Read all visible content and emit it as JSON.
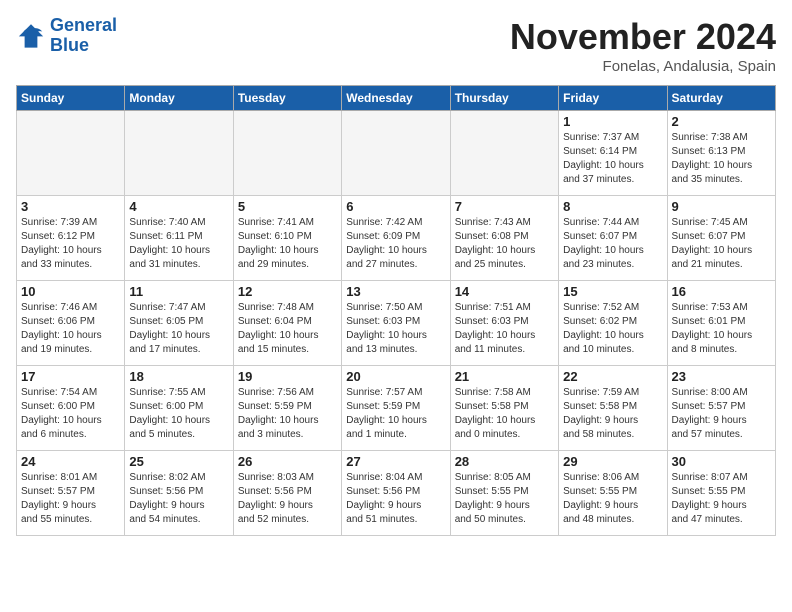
{
  "logo": {
    "line1": "General",
    "line2": "Blue"
  },
  "title": "November 2024",
  "location": "Fonelas, Andalusia, Spain",
  "weekdays": [
    "Sunday",
    "Monday",
    "Tuesday",
    "Wednesday",
    "Thursday",
    "Friday",
    "Saturday"
  ],
  "weeks": [
    [
      {
        "day": "",
        "info": ""
      },
      {
        "day": "",
        "info": ""
      },
      {
        "day": "",
        "info": ""
      },
      {
        "day": "",
        "info": ""
      },
      {
        "day": "",
        "info": ""
      },
      {
        "day": "1",
        "info": "Sunrise: 7:37 AM\nSunset: 6:14 PM\nDaylight: 10 hours\nand 37 minutes."
      },
      {
        "day": "2",
        "info": "Sunrise: 7:38 AM\nSunset: 6:13 PM\nDaylight: 10 hours\nand 35 minutes."
      }
    ],
    [
      {
        "day": "3",
        "info": "Sunrise: 7:39 AM\nSunset: 6:12 PM\nDaylight: 10 hours\nand 33 minutes."
      },
      {
        "day": "4",
        "info": "Sunrise: 7:40 AM\nSunset: 6:11 PM\nDaylight: 10 hours\nand 31 minutes."
      },
      {
        "day": "5",
        "info": "Sunrise: 7:41 AM\nSunset: 6:10 PM\nDaylight: 10 hours\nand 29 minutes."
      },
      {
        "day": "6",
        "info": "Sunrise: 7:42 AM\nSunset: 6:09 PM\nDaylight: 10 hours\nand 27 minutes."
      },
      {
        "day": "7",
        "info": "Sunrise: 7:43 AM\nSunset: 6:08 PM\nDaylight: 10 hours\nand 25 minutes."
      },
      {
        "day": "8",
        "info": "Sunrise: 7:44 AM\nSunset: 6:07 PM\nDaylight: 10 hours\nand 23 minutes."
      },
      {
        "day": "9",
        "info": "Sunrise: 7:45 AM\nSunset: 6:07 PM\nDaylight: 10 hours\nand 21 minutes."
      }
    ],
    [
      {
        "day": "10",
        "info": "Sunrise: 7:46 AM\nSunset: 6:06 PM\nDaylight: 10 hours\nand 19 minutes."
      },
      {
        "day": "11",
        "info": "Sunrise: 7:47 AM\nSunset: 6:05 PM\nDaylight: 10 hours\nand 17 minutes."
      },
      {
        "day": "12",
        "info": "Sunrise: 7:48 AM\nSunset: 6:04 PM\nDaylight: 10 hours\nand 15 minutes."
      },
      {
        "day": "13",
        "info": "Sunrise: 7:50 AM\nSunset: 6:03 PM\nDaylight: 10 hours\nand 13 minutes."
      },
      {
        "day": "14",
        "info": "Sunrise: 7:51 AM\nSunset: 6:03 PM\nDaylight: 10 hours\nand 11 minutes."
      },
      {
        "day": "15",
        "info": "Sunrise: 7:52 AM\nSunset: 6:02 PM\nDaylight: 10 hours\nand 10 minutes."
      },
      {
        "day": "16",
        "info": "Sunrise: 7:53 AM\nSunset: 6:01 PM\nDaylight: 10 hours\nand 8 minutes."
      }
    ],
    [
      {
        "day": "17",
        "info": "Sunrise: 7:54 AM\nSunset: 6:00 PM\nDaylight: 10 hours\nand 6 minutes."
      },
      {
        "day": "18",
        "info": "Sunrise: 7:55 AM\nSunset: 6:00 PM\nDaylight: 10 hours\nand 5 minutes."
      },
      {
        "day": "19",
        "info": "Sunrise: 7:56 AM\nSunset: 5:59 PM\nDaylight: 10 hours\nand 3 minutes."
      },
      {
        "day": "20",
        "info": "Sunrise: 7:57 AM\nSunset: 5:59 PM\nDaylight: 10 hours\nand 1 minute."
      },
      {
        "day": "21",
        "info": "Sunrise: 7:58 AM\nSunset: 5:58 PM\nDaylight: 10 hours\nand 0 minutes."
      },
      {
        "day": "22",
        "info": "Sunrise: 7:59 AM\nSunset: 5:58 PM\nDaylight: 9 hours\nand 58 minutes."
      },
      {
        "day": "23",
        "info": "Sunrise: 8:00 AM\nSunset: 5:57 PM\nDaylight: 9 hours\nand 57 minutes."
      }
    ],
    [
      {
        "day": "24",
        "info": "Sunrise: 8:01 AM\nSunset: 5:57 PM\nDaylight: 9 hours\nand 55 minutes."
      },
      {
        "day": "25",
        "info": "Sunrise: 8:02 AM\nSunset: 5:56 PM\nDaylight: 9 hours\nand 54 minutes."
      },
      {
        "day": "26",
        "info": "Sunrise: 8:03 AM\nSunset: 5:56 PM\nDaylight: 9 hours\nand 52 minutes."
      },
      {
        "day": "27",
        "info": "Sunrise: 8:04 AM\nSunset: 5:56 PM\nDaylight: 9 hours\nand 51 minutes."
      },
      {
        "day": "28",
        "info": "Sunrise: 8:05 AM\nSunset: 5:55 PM\nDaylight: 9 hours\nand 50 minutes."
      },
      {
        "day": "29",
        "info": "Sunrise: 8:06 AM\nSunset: 5:55 PM\nDaylight: 9 hours\nand 48 minutes."
      },
      {
        "day": "30",
        "info": "Sunrise: 8:07 AM\nSunset: 5:55 PM\nDaylight: 9 hours\nand 47 minutes."
      }
    ]
  ]
}
